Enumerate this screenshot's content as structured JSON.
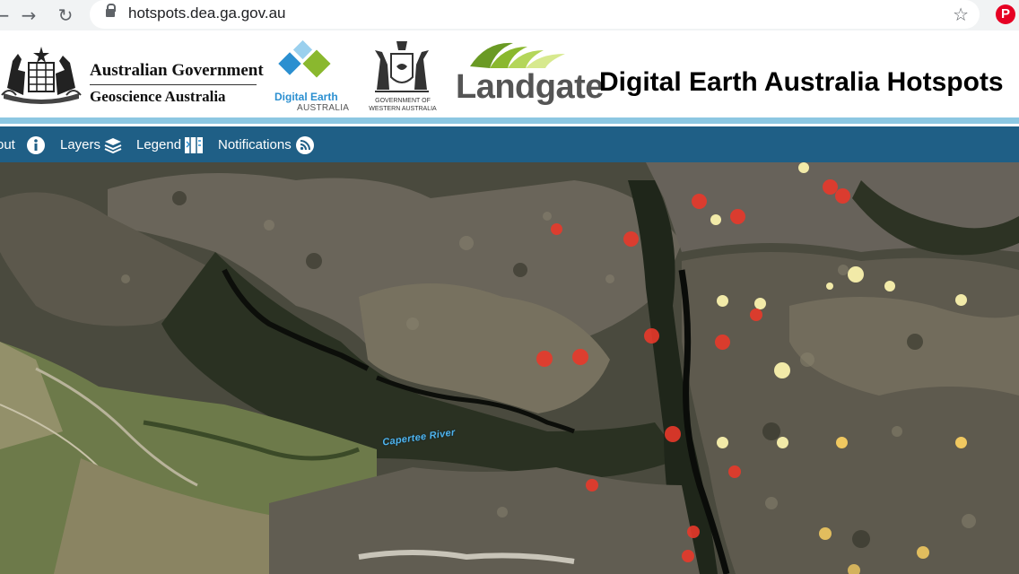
{
  "browser": {
    "url": "hotspots.dea.ga.gov.au",
    "back_icon": "back-arrow-icon",
    "forward_icon": "forward-arrow-icon",
    "reload_icon": "reload-icon",
    "bookmark_icon": "star-icon",
    "extension_icon": "pinterest-icon"
  },
  "header": {
    "gov_line1": "Australian Government",
    "gov_line2": "Geoscience Australia",
    "dea_line1": "Digital Earth",
    "dea_line2": "AUSTRALIA",
    "wa_line1": "GOVERNMENT OF",
    "wa_line2": "WESTERN AUSTRALIA",
    "landgate": "Landgate",
    "title": "Digital Earth Australia Hotspots"
  },
  "nav": {
    "items": [
      {
        "label": "out",
        "icon": "info-icon"
      },
      {
        "label": "Layers",
        "icon": "layers-icon"
      },
      {
        "label": "Legend",
        "icon": "legend-map-icon"
      },
      {
        "label": "Notifications",
        "icon": "rss-icon"
      }
    ]
  },
  "map": {
    "river_label": "Capertee River",
    "colors": {
      "recent": "#e8392a",
      "older": "#f2eaa8",
      "mid": "#f0c860"
    }
  },
  "colors": {
    "nav_bg": "#1f5f86",
    "stripe": "#8cc7e2",
    "dea_blue": "#2b8fd0",
    "landgate_green": "#8ab82e"
  }
}
